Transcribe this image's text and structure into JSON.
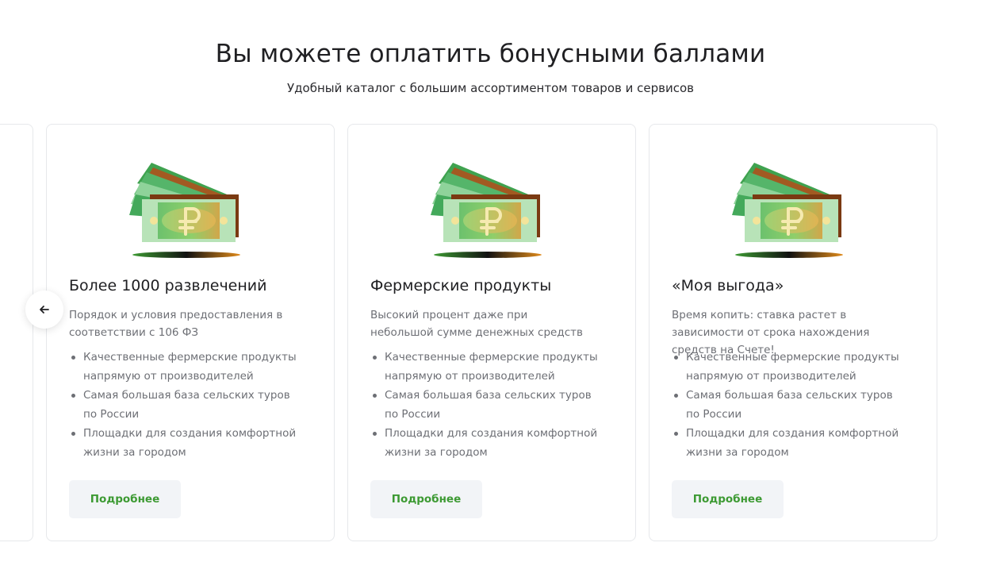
{
  "section": {
    "title": "Вы можете оплатить бонусными баллами",
    "subtitle": "Удобный каталог с большим ассортиментом товаров и сервисов"
  },
  "carousel": {
    "prev_icon": "arrow-left-icon",
    "cards": [
      {
        "icon": "money-stack-ruble-icon",
        "title": "Более 1000 развлечений",
        "description": "Порядок и условия предоставления в соответствии с 106 ФЗ",
        "features": [
          "Качественные фермерские продукты напрямую от производителей",
          "Самая большая база сельских туров по России",
          "Площадки для создания комфортной жизни за городом"
        ],
        "button_label": "Подробнее"
      },
      {
        "icon": "money-stack-ruble-icon",
        "title": "Фермерские продукты",
        "description": "Высокий процент даже при небольшой сумме денежных средств",
        "features": [
          "Качественные фермерские продукты напрямую от производителей",
          "Самая большая база сельских туров по России",
          "Площадки для создания комфортной жизни за городом"
        ],
        "button_label": "Подробнее"
      },
      {
        "icon": "money-stack-ruble-icon",
        "title": "«Моя выгода»",
        "description": "Время копить: ставка растет в зависимости от срока нахождения средств на Счете!",
        "features": [
          "Качественные фермерские продукты напрямую от производителей",
          "Самая большая база сельских туров по России",
          "Площадки для создания комфортной жизни за городом"
        ],
        "button_label": "Подробнее"
      }
    ]
  },
  "colors": {
    "accent_green": "#3d9a33",
    "button_bg": "#f2f4f7",
    "text_primary": "#1f1f22",
    "text_secondary": "#6d6f75",
    "card_border": "#e6e8eb"
  }
}
